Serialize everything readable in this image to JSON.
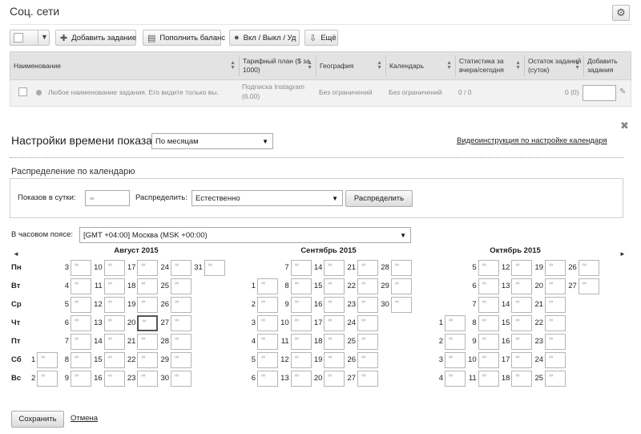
{
  "header": {
    "title": "Соц. сети",
    "settings_icon": "gear-icon"
  },
  "toolbar": {
    "add_task": "Добавить задание",
    "top_up": "Пополнить баланс",
    "toggle": "Вкл / Выкл / Уд",
    "more": "Ещё"
  },
  "table": {
    "columns": [
      "Наименование",
      "Тарифный план ($ за 1000)",
      "География",
      "Календарь",
      "Статистика за вчера/сегодня",
      "Остаток заданий (суток)",
      "Добавить задания"
    ],
    "row": {
      "name": "Любое наименование задания. Его видите только вы.",
      "plan_line1": "Подписка Instagram",
      "plan_line2": "(6.00)",
      "geo": "Без ограничений",
      "calendar": "Без ограничений",
      "stats": "0 / 0",
      "remaining": "0 (0)"
    }
  },
  "settings": {
    "title": "Настройки времени показа",
    "mode": "По месяцам",
    "video_link": "Видеоинструкция по настройке календаря",
    "distribution_title": "Распределение по календарю",
    "per_day_label": "Показов в сутки:",
    "per_day_value": "∞",
    "distribute_label": "Распределить:",
    "distribute_value": "Естественно",
    "distribute_button": "Распределить",
    "timezone_label": "В часовом поясе:",
    "timezone_value": "[GMT +04:00] Москва (MSK +00:00)"
  },
  "calendar": {
    "weekdays": [
      "Пн",
      "Вт",
      "Ср",
      "Чт",
      "Пт",
      "Сб",
      "Вс"
    ],
    "empty_value": "∞",
    "selected_day": "Август 2015 / 20",
    "months": [
      {
        "title": "Август 2015",
        "weeks": [
          [
            "",
            "",
            "",
            "",
            "",
            1,
            2
          ],
          [
            3,
            4,
            5,
            6,
            7,
            8,
            9
          ],
          [
            10,
            11,
            12,
            13,
            14,
            15,
            16
          ],
          [
            17,
            18,
            19,
            20,
            21,
            22,
            23
          ],
          [
            24,
            25,
            26,
            27,
            28,
            29,
            30
          ],
          [
            31,
            "",
            "",
            "",
            "",
            "",
            ""
          ]
        ]
      },
      {
        "title": "Сентябрь 2015",
        "weeks": [
          [
            "",
            1,
            2,
            3,
            4,
            5,
            6
          ],
          [
            7,
            8,
            9,
            10,
            11,
            12,
            13
          ],
          [
            14,
            15,
            16,
            17,
            18,
            19,
            20
          ],
          [
            21,
            22,
            23,
            24,
            25,
            26,
            27
          ],
          [
            28,
            29,
            30,
            "",
            "",
            "",
            ""
          ]
        ]
      },
      {
        "title": "Октябрь 2015",
        "weeks": [
          [
            "",
            "",
            "",
            1,
            2,
            3,
            4
          ],
          [
            5,
            6,
            7,
            8,
            9,
            10,
            11
          ],
          [
            12,
            13,
            14,
            15,
            16,
            17,
            18
          ],
          [
            19,
            20,
            21,
            22,
            23,
            24,
            25
          ],
          [
            26,
            27,
            "",
            "",
            "",
            "",
            ""
          ]
        ]
      }
    ]
  },
  "footer": {
    "save": "Сохранить",
    "cancel": "Отмена"
  }
}
